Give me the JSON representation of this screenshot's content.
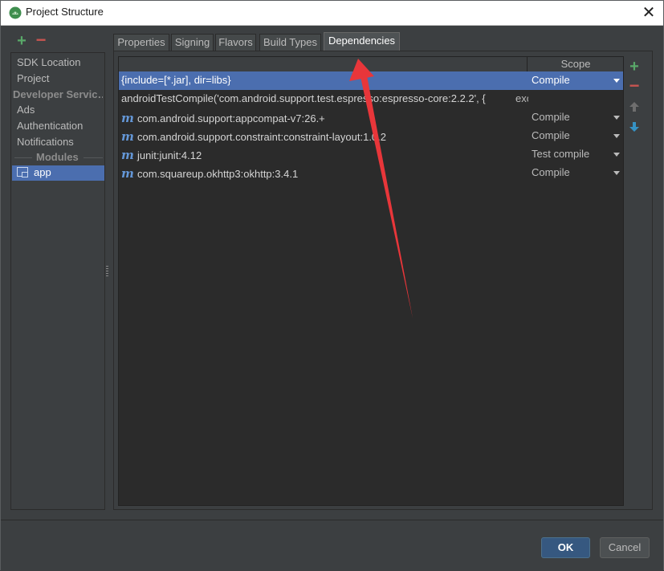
{
  "window": {
    "title": "Project Structure",
    "close_label": "✕"
  },
  "sidebar": {
    "items": [
      {
        "label": "SDK Location"
      },
      {
        "label": "Project"
      }
    ],
    "developer_services_header": "Developer Servic…",
    "services": [
      {
        "label": "Ads"
      },
      {
        "label": "Authentication"
      },
      {
        "label": "Notifications"
      }
    ],
    "modules_header": "Modules",
    "modules": [
      {
        "label": "app"
      }
    ]
  },
  "tabs": [
    {
      "label": "Properties"
    },
    {
      "label": "Signing"
    },
    {
      "label": "Flavors"
    },
    {
      "label": "Build Types"
    },
    {
      "label": "Dependencies"
    }
  ],
  "active_tab": "Dependencies",
  "table": {
    "columns": [
      "",
      "Scope"
    ],
    "rows": [
      {
        "name": "{include=[*.jar], dir=libs}",
        "scope": "Compile",
        "maven": false
      },
      {
        "name": "androidTestCompile('com.android.support.test.espresso:espresso-core:2.2.2', {",
        "scope": "exclude",
        "maven": false
      },
      {
        "name": "com.android.support:appcompat-v7:26.+",
        "scope": "Compile",
        "maven": true
      },
      {
        "name": "com.android.support.constraint:constraint-layout:1.0.2",
        "scope": "Compile",
        "maven": true
      },
      {
        "name": "junit:junit:4.12",
        "scope": "Test compile",
        "maven": true
      },
      {
        "name": "com.squareup.okhttp3:okhttp:3.4.1",
        "scope": "Compile",
        "maven": true
      }
    ]
  },
  "icons": {
    "maven": "m",
    "plus": "+",
    "minus": "−"
  },
  "buttons": {
    "ok": "OK",
    "cancel": "Cancel"
  },
  "colors": {
    "accent": "#4b6eaf",
    "annotation_arrow": "#e8363a",
    "add": "#59a869",
    "remove": "#c75450"
  }
}
